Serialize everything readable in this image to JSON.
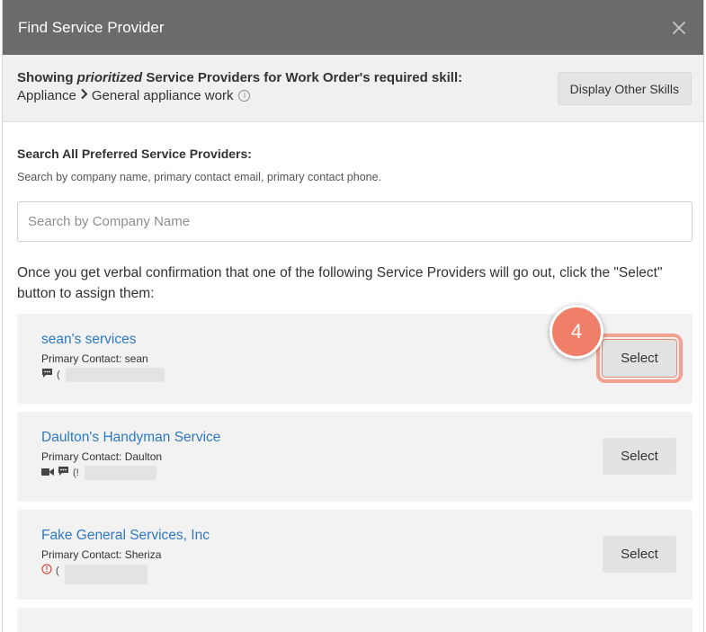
{
  "modal": {
    "title": "Find Service Provider",
    "close_icon": "close-icon"
  },
  "skill_bar": {
    "prefix": "Showing ",
    "emphasis": "prioritized",
    "suffix": " Service Providers for Work Order's required skill:",
    "category": "Appliance",
    "skill": "General appliance work",
    "info_icon": "i",
    "other_skills_label": "Display Other Skills"
  },
  "search": {
    "heading": "Search All Preferred Service Providers:",
    "subtext": "Search by company name, primary contact email, primary contact phone.",
    "placeholder": "Search by Company Name",
    "value": ""
  },
  "instruction": "Once you get verbal confirmation that one of the following Service Providers will go out, click the \"Select\" button to assign them:",
  "providers": [
    {
      "name": "sean's services",
      "contact": "Primary Contact: sean",
      "channels": [
        "message-icon"
      ],
      "phone_prefix": "(",
      "select_label": "Select",
      "highlighted": true
    },
    {
      "name": "Daulton's Handyman Service",
      "contact": "Primary Contact: Daulton",
      "channels": [
        "video-icon",
        "message-icon"
      ],
      "phone_prefix": "(!",
      "select_label": "Select",
      "highlighted": false
    },
    {
      "name": "Fake General Services, Inc",
      "contact": "Primary Contact: Sheriza",
      "channels": [
        "alert-icon"
      ],
      "phone_prefix": "(",
      "select_label": "Select",
      "highlighted": false
    }
  ],
  "step_badge": "4",
  "colors": {
    "header_bg": "#6b6b6b",
    "link": "#2f79c2",
    "badge": "#ef7f69",
    "highlight": "#f2a08f",
    "alert": "#d9534f"
  }
}
